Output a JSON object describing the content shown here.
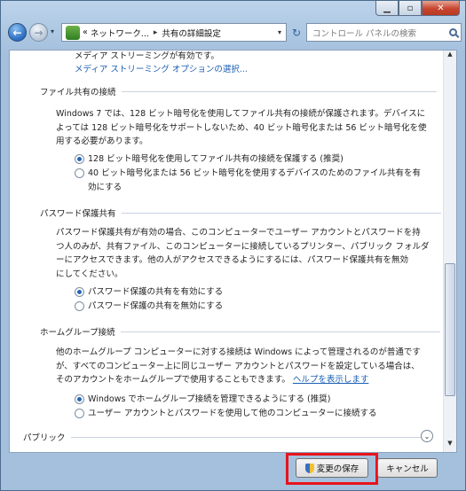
{
  "address": {
    "history_glyph": "«",
    "crumbs": [
      "ネットワーク...",
      "共有の詳細設定"
    ],
    "separator": "▸",
    "dropdown": "▾"
  },
  "search": {
    "placeholder": "コントロール パネルの検索"
  },
  "top_partial": {
    "line1": "メディア ストリーミングが有効です。",
    "link": "メディア ストリーミング オプションの選択..."
  },
  "sections": {
    "file_sharing": {
      "title": "ファイル共有の接続",
      "desc": [
        "Windows 7 では、128 ビット暗号化を使用してファイル共有の接続が保護されます。デバイスに",
        "よっては 128 ビット暗号化をサポートしないため、40 ビット暗号化または 56 ビット暗号化を使",
        "用する必要があります。"
      ],
      "options": [
        [
          "128 ビット暗号化を使用してファイル共有の接続を保護する (推奨)"
        ],
        [
          "40 ビット暗号化または 56 ビット暗号化を使用するデバイスのためのファイル共有を有",
          "効にする"
        ]
      ]
    },
    "password": {
      "title": "パスワード保護共有",
      "desc": [
        "パスワード保護共有が有効の場合、このコンピューターでユーザー アカウントとパスワードを持",
        "つ人のみが、共有ファイル、このコンピューターに接続しているプリンター、パブリック フォルダ",
        "ーにアクセスできます。他の人がアクセスできるようにするには、パスワード保護共有を無効",
        "にしてください。"
      ],
      "options": [
        "パスワード保護の共有を有効にする",
        "パスワード保護の共有を無効にする"
      ]
    },
    "homegroup": {
      "title": "ホームグループ接続",
      "desc": [
        "他のホームグループ コンピューターに対する接続は Windows によって管理されるのが普通です",
        "が、すべてのコンピューター上に同じユーザー アカウントとパスワードを設定している場合は、",
        "そのアカウントをホームグループで使用することもできます。"
      ],
      "help_link": "ヘルプを表示します",
      "options": [
        "Windows でホームグループ接続を管理できるようにする (推奨)",
        "ユーザー アカウントとパスワードを使用して他のコンピューターに接続する"
      ]
    },
    "public": {
      "title": "パブリック"
    }
  },
  "buttons": {
    "save": "変更の保存",
    "cancel": "キャンセル"
  }
}
